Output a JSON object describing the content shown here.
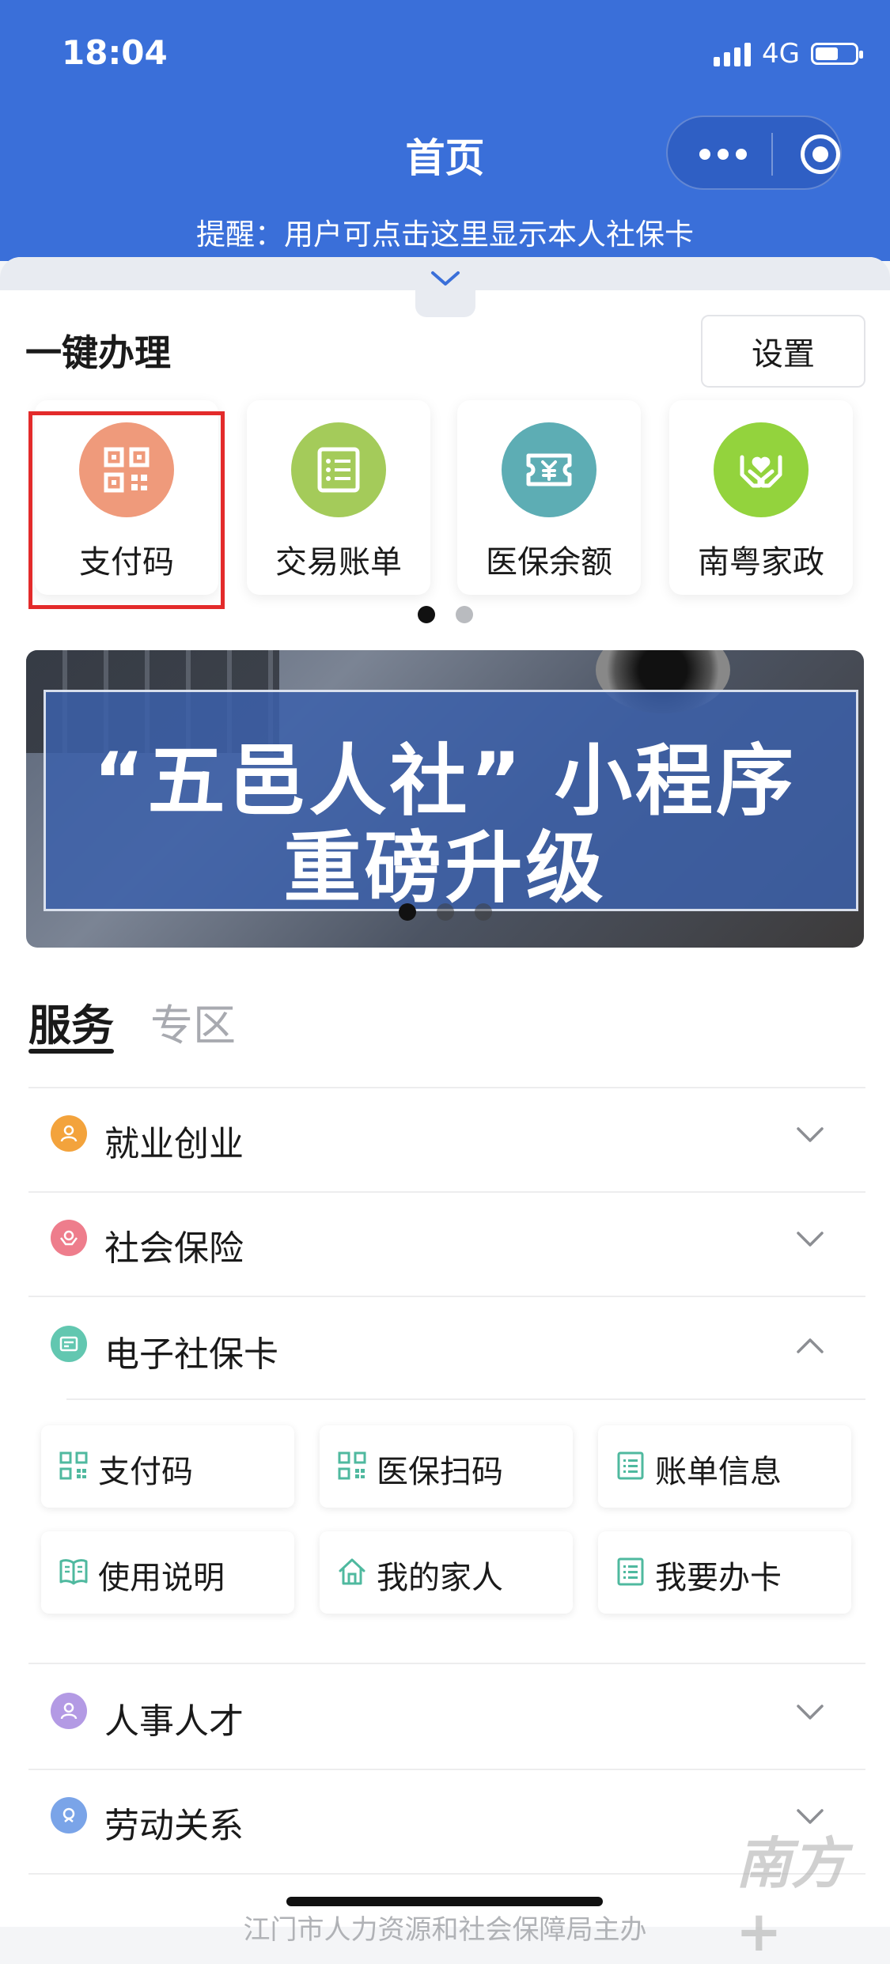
{
  "status_bar": {
    "time": "18:04",
    "network": "4G"
  },
  "header": {
    "title": "首页",
    "reminder": "提醒：用户可点击这里显示本人社保卡"
  },
  "quick": {
    "title": "一键办理",
    "settings_label": "设置",
    "items": [
      {
        "label": "支付码",
        "icon": "qr-code-icon",
        "color": "#ef9a7b"
      },
      {
        "label": "交易账单",
        "icon": "bill-list-icon",
        "color": "#a4cb5a"
      },
      {
        "label": "医保余额",
        "icon": "yuan-ticket-icon",
        "color": "#5dadb4"
      },
      {
        "label": "南粤家政",
        "icon": "hands-heart-icon",
        "color": "#93d33d"
      }
    ]
  },
  "banner": {
    "line1": "“五邑人社” 小程序",
    "line2": "重磅升级"
  },
  "tabs": [
    {
      "label": "服务",
      "active": true
    },
    {
      "label": "专区",
      "active": false
    }
  ],
  "services": [
    {
      "label": "就业创业",
      "icon": "person-badge-icon",
      "color": "#f3a33c",
      "expanded": false
    },
    {
      "label": "社会保险",
      "icon": "care-hands-icon",
      "color": "#ee7d8c",
      "expanded": false
    },
    {
      "label": "电子社保卡",
      "icon": "card-icon",
      "color": "#62c7b0",
      "expanded": true
    },
    {
      "label": "人事人才",
      "icon": "user-icon",
      "color": "#b39ae4",
      "expanded": false
    },
    {
      "label": "劳动关系",
      "icon": "handshake-icon",
      "color": "#7aa4e8",
      "expanded": false
    }
  ],
  "ecard_items": [
    {
      "label": "支付码",
      "icon": "qr-code-icon"
    },
    {
      "label": "医保扫码",
      "icon": "scan-code-icon"
    },
    {
      "label": "账单信息",
      "icon": "bill-list-icon"
    },
    {
      "label": "使用说明",
      "icon": "book-icon"
    },
    {
      "label": "我的家人",
      "icon": "home-icon"
    },
    {
      "label": "我要办卡",
      "icon": "apply-card-icon"
    }
  ],
  "footer": {
    "text": "江门市人力资源和社会保障局主办"
  },
  "colors": {
    "header_blue": "#3a6fd9",
    "accent_green": "#4fb99f",
    "highlight_red": "#e32b2b"
  }
}
